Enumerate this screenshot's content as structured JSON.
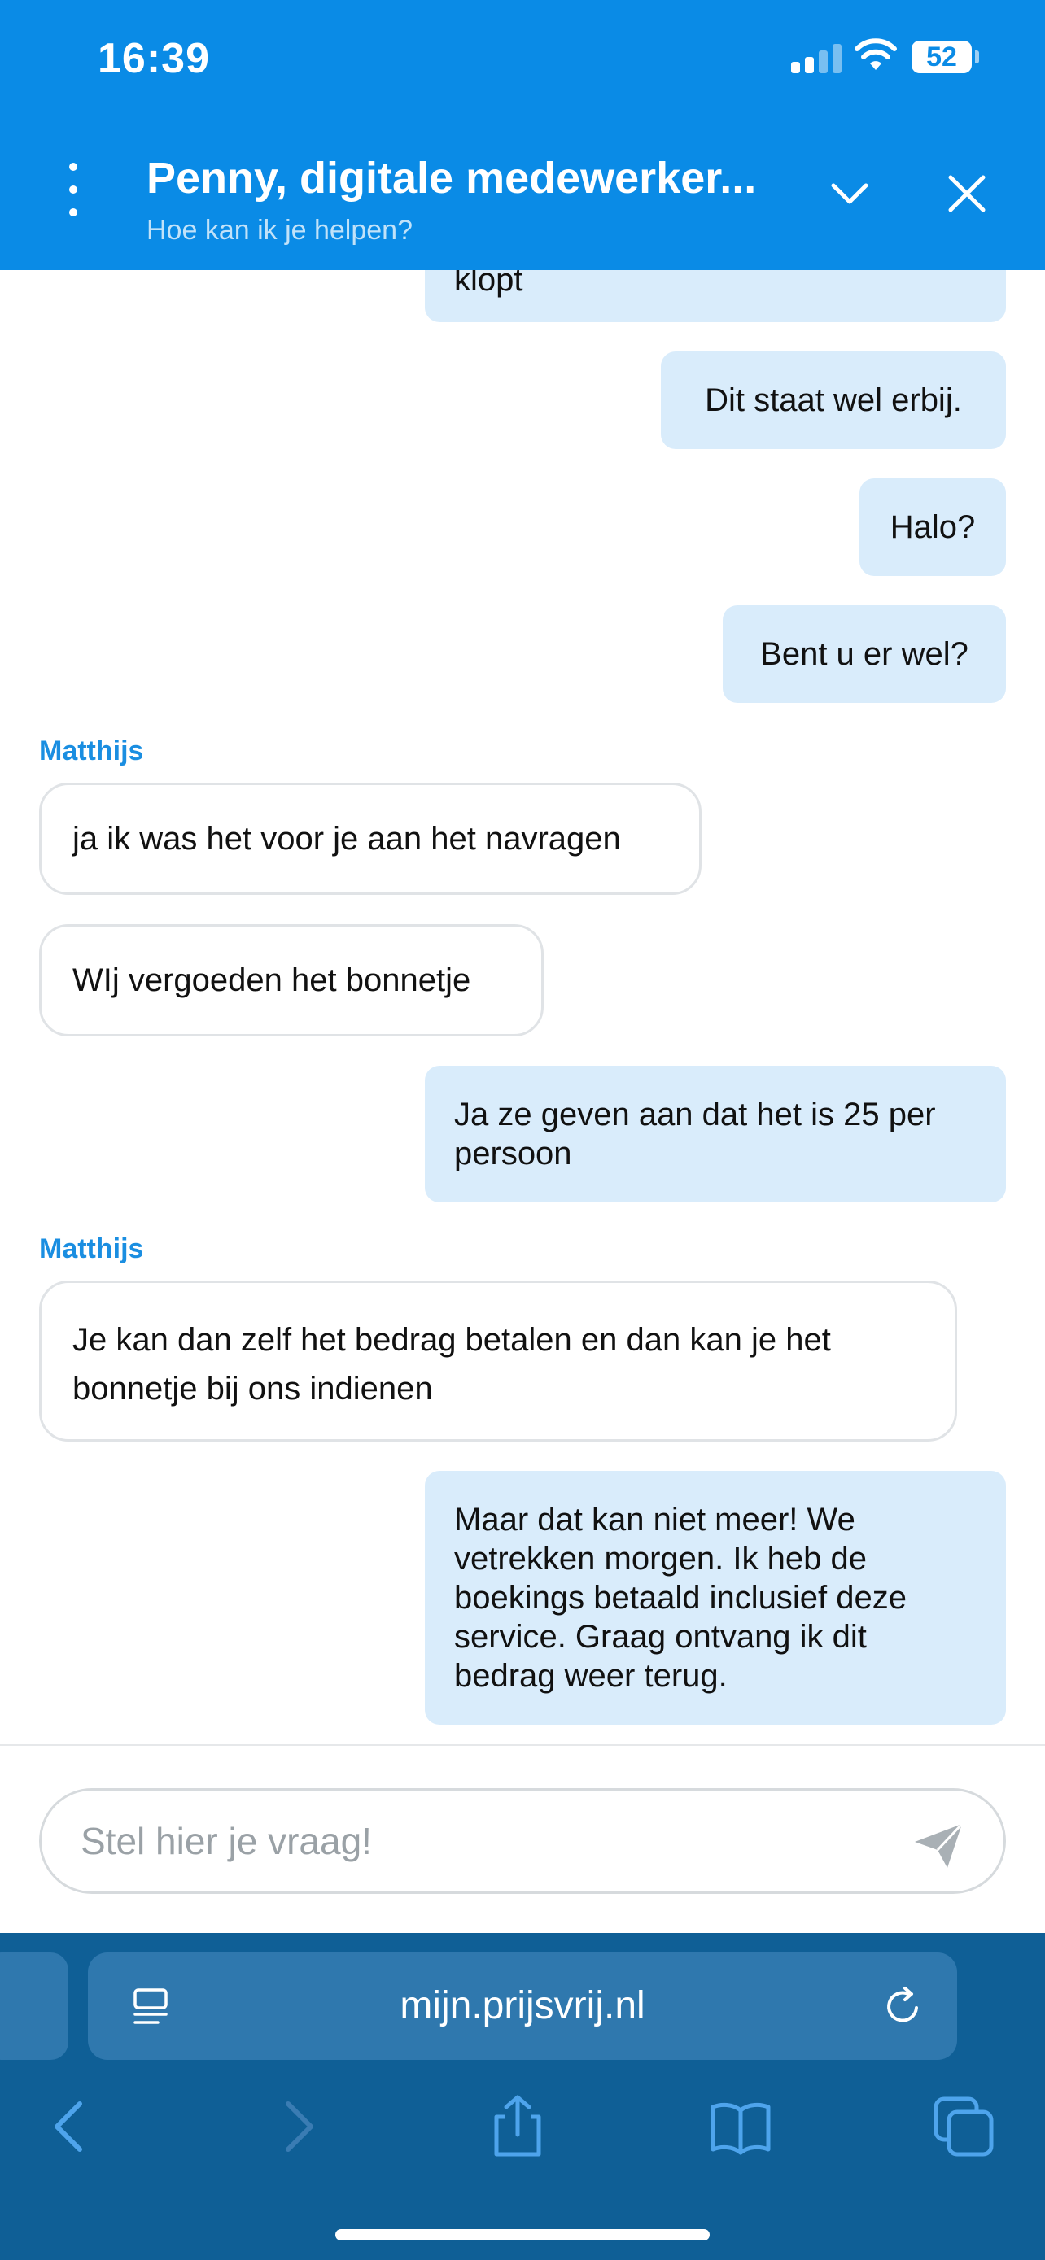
{
  "status_bar": {
    "time": "16:39",
    "battery": "52"
  },
  "header": {
    "title": "Penny, digitale medewerker...",
    "subtitle": "Hoe kan ik je helpen?"
  },
  "chat": {
    "messages": [
      {
        "from": "user",
        "text": "klopt"
      },
      {
        "from": "user",
        "text": "Dit staat wel erbij."
      },
      {
        "from": "user",
        "text": "Halo?"
      },
      {
        "from": "user",
        "text": "Bent u er wel?"
      },
      {
        "from": "agent",
        "sender": "Matthijs",
        "text": "ja ik was het voor je aan het navragen"
      },
      {
        "from": "agent",
        "text": "WIj vergoeden het bonnetje"
      },
      {
        "from": "user",
        "text": "Ja ze geven aan dat het is 25 per persoon"
      },
      {
        "from": "agent",
        "sender": "Matthijs",
        "text": "Je kan dan zelf het bedrag betalen en dan kan je het bonnetje bij ons indienen"
      },
      {
        "from": "user",
        "text": "Maar dat kan niet meer! We vetrekken morgen. Ik heb de boekings betaald inclusief deze service. Graag ontvang ik dit bedrag weer terug."
      }
    ]
  },
  "input": {
    "placeholder": "Stel hier je vraag!"
  },
  "browser": {
    "url": "mijn.prijsvrij.nl"
  },
  "colors": {
    "header_bg": "#0a8be6",
    "user_bubble": "#d9ecfb",
    "agent_name": "#1a8ee1",
    "safari_bg": "#0f5f96"
  },
  "icons": [
    "signal-icon",
    "wifi-icon",
    "battery-icon",
    "kebab-menu-icon",
    "chevron-down-icon",
    "close-icon",
    "send-icon",
    "page-format-icon",
    "reload-icon",
    "back-icon",
    "forward-icon",
    "share-icon",
    "bookmarks-icon",
    "tabs-icon"
  ]
}
